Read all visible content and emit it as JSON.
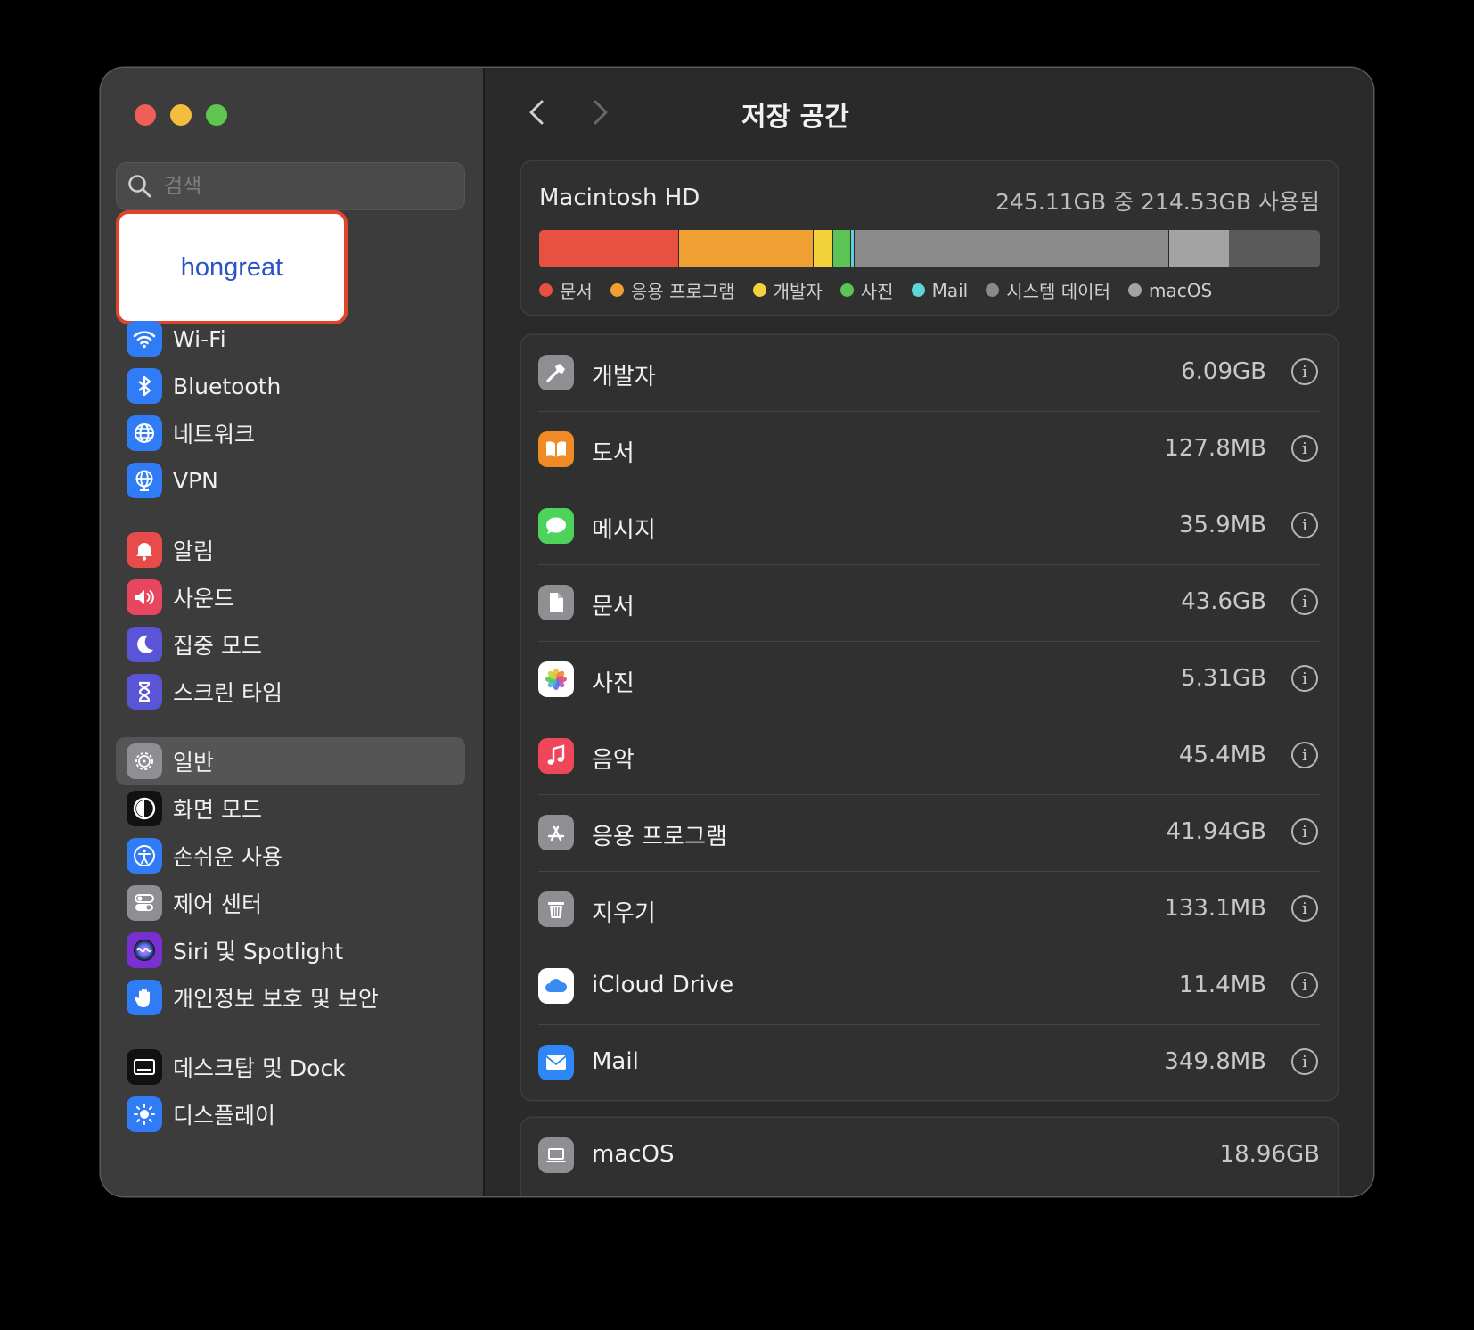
{
  "sidebar": {
    "search_placeholder": "검색",
    "account_name": "hongreat",
    "items": [
      {
        "label": "Wi-Fi",
        "icon": "wifi-icon",
        "color": "#2f7cf6"
      },
      {
        "label": "Bluetooth",
        "icon": "bluetooth-icon",
        "color": "#2f7cf6"
      },
      {
        "label": "네트워크",
        "icon": "globe-icon",
        "color": "#2f7cf6"
      },
      {
        "label": "VPN",
        "icon": "vpn-globe-icon",
        "color": "#2f7cf6"
      },
      {
        "label": "알림",
        "icon": "bell-icon",
        "color": "#e84c4a"
      },
      {
        "label": "사운드",
        "icon": "speaker-icon",
        "color": "#e8455f"
      },
      {
        "label": "집중 모드",
        "icon": "moon-icon",
        "color": "#5a55d6"
      },
      {
        "label": "스크린 타임",
        "icon": "hourglass-icon",
        "color": "#5a55d6"
      },
      {
        "label": "일반",
        "icon": "gear-icon",
        "color": "#8e8e93"
      },
      {
        "label": "화면 모드",
        "icon": "appearance-icon",
        "color": "#111111"
      },
      {
        "label": "손쉬운 사용",
        "icon": "accessibility-icon",
        "color": "#2f7cf6"
      },
      {
        "label": "제어 센터",
        "icon": "toggles-icon",
        "color": "#8e8e93"
      },
      {
        "label": "Siri 및 Spotlight",
        "icon": "siri-icon",
        "color": "#7a2fd0"
      },
      {
        "label": "개인정보 보호 및 보안",
        "icon": "hand-icon",
        "color": "#2f7cf6"
      },
      {
        "label": "데스크탑 및 Dock",
        "icon": "dock-icon",
        "color": "#111111"
      },
      {
        "label": "디스플레이",
        "icon": "brightness-icon",
        "color": "#2f7cf6"
      }
    ],
    "selected": "일반"
  },
  "header": {
    "title": "저장 공간"
  },
  "disk": {
    "name": "Macintosh HD",
    "usage": "245.11GB 중 214.53GB 사용됨",
    "segments": [
      {
        "label": "문서",
        "gb": 43.6,
        "color": "#e8503f"
      },
      {
        "label": "응용 프로그램",
        "gb": 41.94,
        "color": "#f0a032"
      },
      {
        "label": "개발자",
        "gb": 6.09,
        "color": "#f3d13a"
      },
      {
        "label": "사진",
        "gb": 5.31,
        "color": "#5cc454"
      },
      {
        "label": "Mail",
        "gb": 0.35,
        "color": "#5ed3d8"
      },
      {
        "label": "시스템 데이터",
        "gb": 98.3,
        "color": "#8a8a8a"
      },
      {
        "label": "macOS",
        "gb": 18.96,
        "color": "#a3a3a3"
      }
    ],
    "total_gb": 245.11
  },
  "categories": [
    {
      "label": "개발자",
      "size": "6.09GB",
      "icon": "hammer-icon",
      "color": "#8e8e93"
    },
    {
      "label": "도서",
      "size": "127.8MB",
      "icon": "book-icon",
      "color": "#f08a24"
    },
    {
      "label": "메시지",
      "size": "35.9MB",
      "icon": "message-bubble-icon",
      "color": "#4cd35c"
    },
    {
      "label": "문서",
      "size": "43.6GB",
      "icon": "document-icon",
      "color": "#8e8e93"
    },
    {
      "label": "사진",
      "size": "5.31GB",
      "icon": "photos-flower-icon",
      "color": "#ffffff"
    },
    {
      "label": "음악",
      "size": "45.4MB",
      "icon": "music-note-icon",
      "color": "#f0465a"
    },
    {
      "label": "응용 프로그램",
      "size": "41.94GB",
      "icon": "app-store-icon",
      "color": "#8e8e93"
    },
    {
      "label": "지우기",
      "size": "133.1MB",
      "icon": "trash-icon",
      "color": "#8e8e93"
    },
    {
      "label": "iCloud Drive",
      "size": "11.4MB",
      "icon": "cloud-icon",
      "color": "#ffffff"
    },
    {
      "label": "Mail",
      "size": "349.8MB",
      "icon": "envelope-icon",
      "color": "#2f86f6"
    }
  ],
  "system": [
    {
      "label": "macOS",
      "size": "18.96GB",
      "icon": "laptop-icon",
      "color": "#8e8e93"
    }
  ]
}
